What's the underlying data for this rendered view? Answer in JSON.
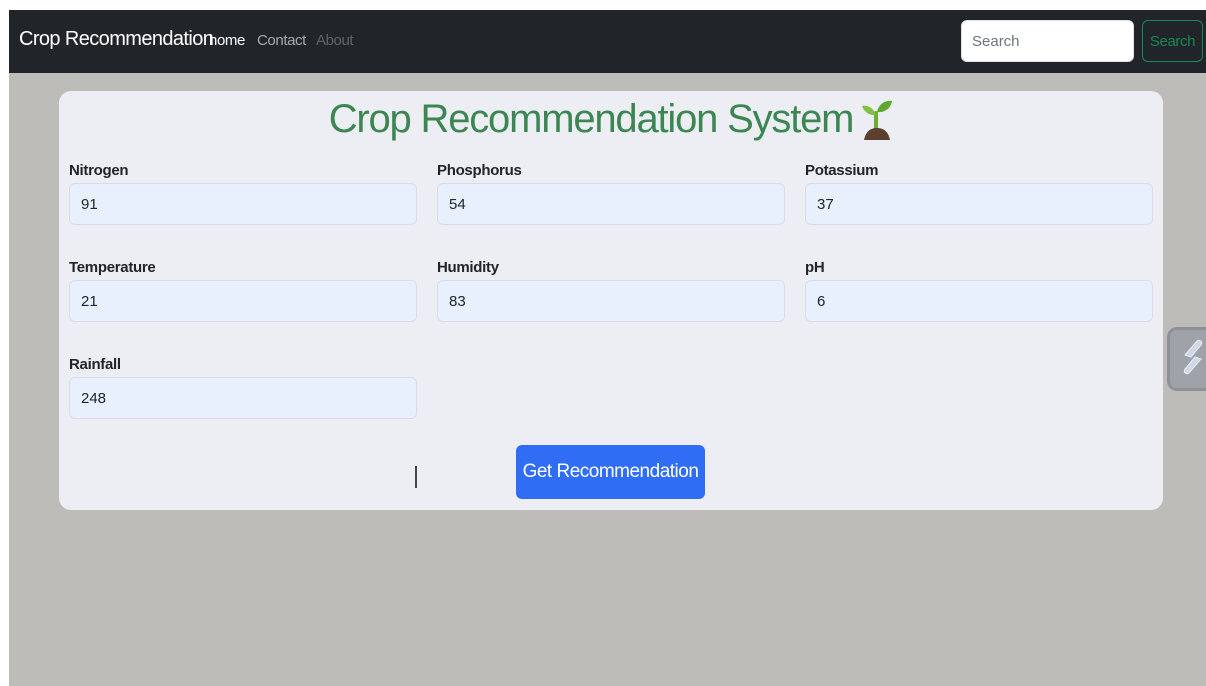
{
  "navbar": {
    "brand": "Crop Recommendation",
    "links": [
      {
        "label": "home",
        "state": "active"
      },
      {
        "label": "Contact",
        "state": "normal"
      },
      {
        "label": "About",
        "state": "disabled"
      }
    ],
    "search": {
      "placeholder": "Search",
      "value": "",
      "button_label": "Search"
    }
  },
  "form": {
    "title": "Crop Recommendation System",
    "title_icon": "seedling-icon",
    "fields": [
      {
        "label": "Nitrogen",
        "value": "91"
      },
      {
        "label": "Phosphorus",
        "value": "54"
      },
      {
        "label": "Potassium",
        "value": "37"
      },
      {
        "label": "Temperature",
        "value": "21"
      },
      {
        "label": "Humidity",
        "value": "83"
      },
      {
        "label": "pH",
        "value": "6"
      },
      {
        "label": "Rainfall",
        "value": "248"
      }
    ],
    "submit_label": "Get Recommendation"
  },
  "side_widget": {
    "icon": "link-slash-icon"
  },
  "colors": {
    "navbar_bg": "#212529",
    "page_bg": "#bdbcb8",
    "card_bg": "#eceef3",
    "title": "#3c8652",
    "input_bg": "#e8f0fe",
    "primary": "#2f6df5",
    "success": "#198754"
  }
}
